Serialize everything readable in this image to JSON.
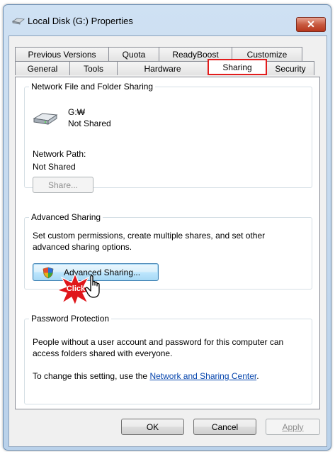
{
  "window": {
    "title": "Local Disk (G:) Properties",
    "close_glyph": "✕"
  },
  "tabs": {
    "row1": [
      "Previous Versions",
      "Quota",
      "ReadyBoost",
      "Customize"
    ],
    "row2": [
      "General",
      "Tools",
      "Hardware",
      "Sharing",
      "Security"
    ],
    "active": "Sharing"
  },
  "network_sharing": {
    "legend": "Network File and Folder Sharing",
    "drive_name": "G:₩",
    "drive_status": "Not Shared",
    "path_label": "Network Path:",
    "path_value": "Not Shared",
    "share_button": "Share..."
  },
  "advanced_sharing": {
    "legend": "Advanced Sharing",
    "description": "Set custom permissions, create multiple shares, and set other advanced sharing options.",
    "button": "Advanced Sharing...",
    "click_badge": "Click"
  },
  "password_protection": {
    "legend": "Password Protection",
    "description": "People without a user account and password for this computer can access folders shared with everyone.",
    "change_prefix": "To change this setting, use the ",
    "change_link": "Network and Sharing Center",
    "change_suffix": "."
  },
  "footer": {
    "ok": "OK",
    "cancel": "Cancel",
    "apply": "Apply"
  },
  "colors": {
    "highlight": "#e21c1c",
    "link": "#0645ad"
  }
}
